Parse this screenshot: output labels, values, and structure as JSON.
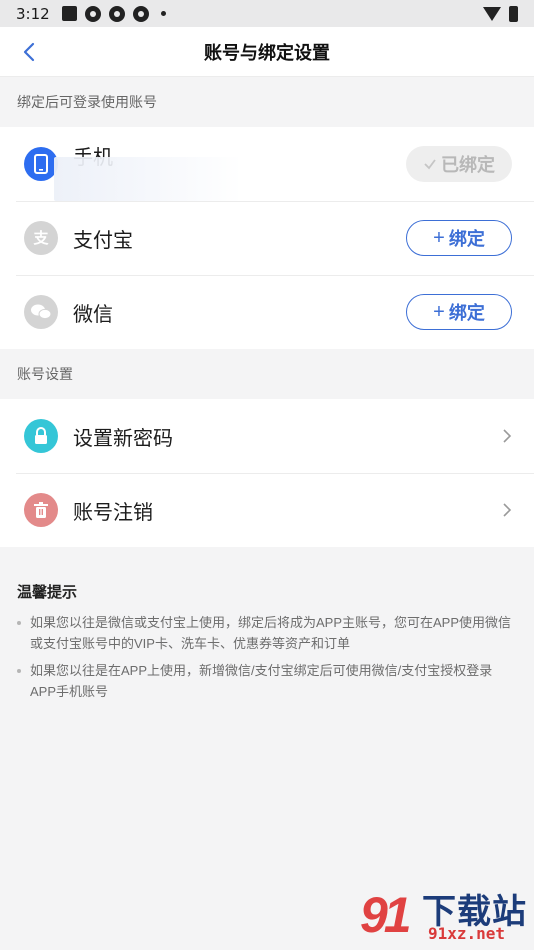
{
  "status_bar": {
    "time": "3:12"
  },
  "nav": {
    "title": "账号与绑定设置"
  },
  "bind_section": {
    "label": "绑定后可登录使用账号",
    "rows": [
      {
        "label": "手机",
        "status": "已绑定",
        "icon": "phone-icon",
        "color": "#2d6df0"
      },
      {
        "label": "支付宝",
        "action": "绑定",
        "icon": "alipay-icon",
        "color": "#d4d4d4"
      },
      {
        "label": "微信",
        "action": "绑定",
        "icon": "wechat-icon",
        "color": "#d4d4d4"
      }
    ]
  },
  "account_section": {
    "label": "账号设置",
    "rows": [
      {
        "label": "设置新密码",
        "icon": "lock-icon",
        "color": "#35c6d7"
      },
      {
        "label": "账号注销",
        "icon": "trash-icon",
        "color": "#e38a8a"
      }
    ]
  },
  "tips": {
    "title": "温馨提示",
    "items": [
      "如果您以往是微信或支付宝上使用，绑定后将成为APP主账号，您可在APP使用微信或支付宝账号中的VIP卡、洗车卡、优惠券等资产和订单",
      "如果您以往是在APP上使用，新增微信/支付宝绑定后可使用微信/支付宝授权登录APP手机账号"
    ]
  },
  "watermark": {
    "text": "下载站",
    "url": "91xz.net",
    "logo": "91"
  },
  "colors": {
    "accent": "#3d6fd6",
    "background": "#f4f4f5"
  }
}
